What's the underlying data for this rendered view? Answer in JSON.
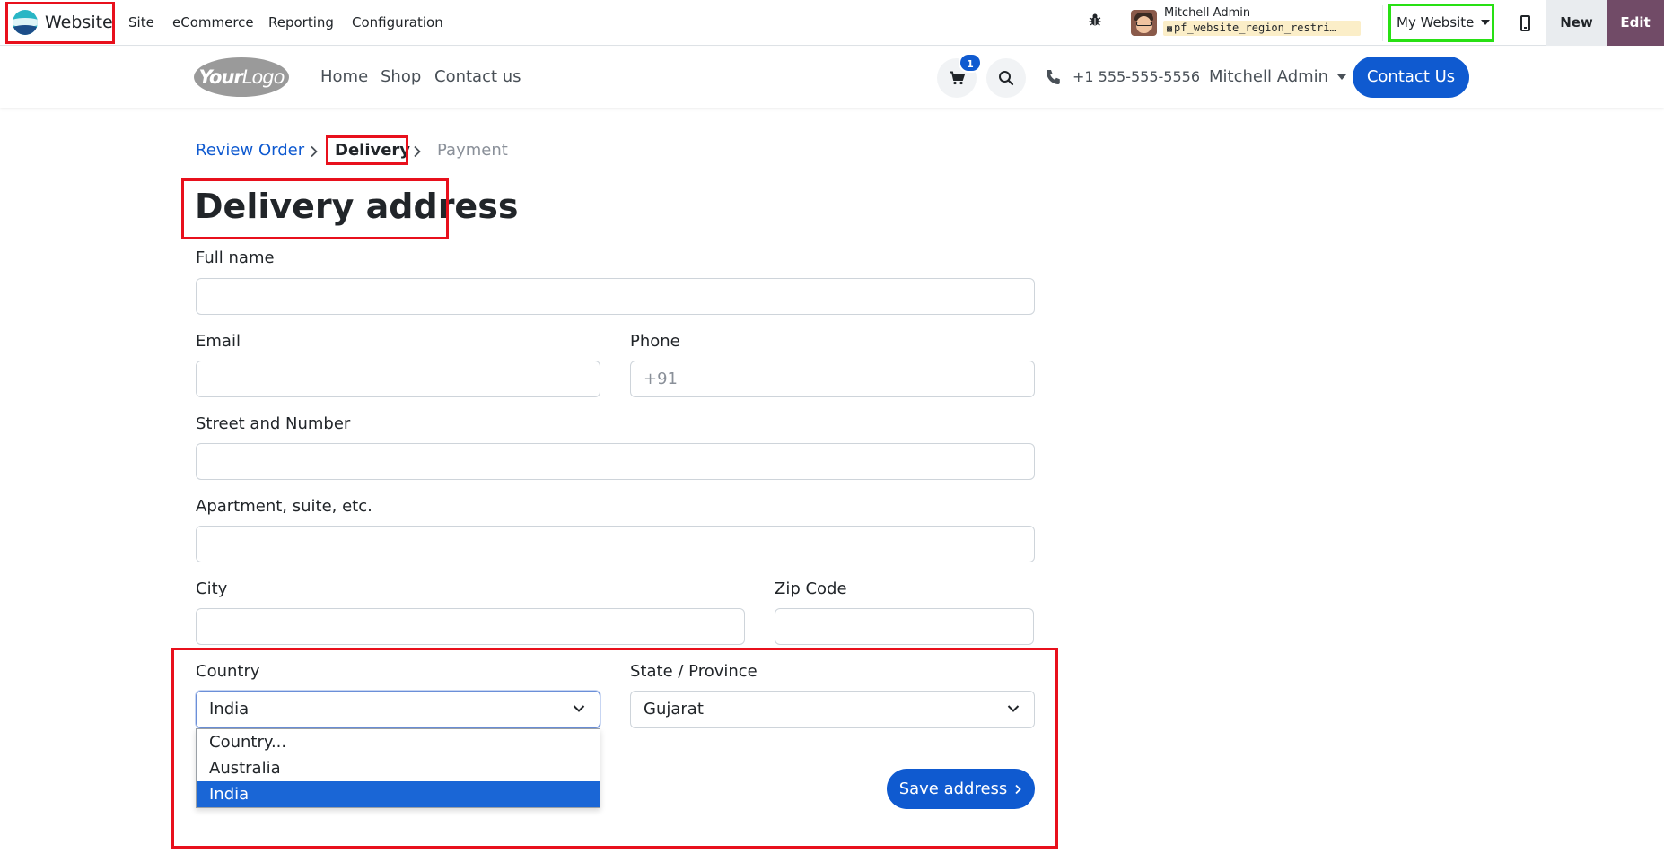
{
  "odoo_bar": {
    "app_name": "Website",
    "menu": [
      "Site",
      "eCommerce",
      "Reporting",
      "Configuration"
    ],
    "user_name": "Mitchell Admin",
    "database": "pf_website_region_restri…",
    "website_switcher": "My Website",
    "new_label": "New",
    "edit_label": "Edit",
    "edit_color": "#714b67"
  },
  "site_header": {
    "logo_text_bold": "Your",
    "logo_text_light": "Logo",
    "nav": [
      "Home",
      "Shop",
      "Contact us"
    ],
    "cart_count": "1",
    "phone": "+1 555-555-5556",
    "user": "Mitchell Admin",
    "contact_button": "Contact Us",
    "accent_color": "#0f5ad0"
  },
  "steps": {
    "review": "Review Order",
    "delivery": "Delivery",
    "payment": "Payment"
  },
  "form": {
    "title": "Delivery address",
    "full_name": {
      "label": "Full name",
      "value": ""
    },
    "email": {
      "label": "Email",
      "value": ""
    },
    "phone": {
      "label": "Phone",
      "placeholder": "+91"
    },
    "street": {
      "label": "Street and Number",
      "value": ""
    },
    "apartment": {
      "label": "Apartment, suite, etc.",
      "value": ""
    },
    "city": {
      "label": "City",
      "value": ""
    },
    "zip": {
      "label": "Zip Code",
      "value": ""
    },
    "country": {
      "label": "Country",
      "selected": "India",
      "options": [
        "Country...",
        "Australia",
        "India"
      ]
    },
    "state": {
      "label": "State / Province",
      "selected": "Gujarat"
    },
    "save_button": "Save address"
  },
  "icons": {
    "bug": "bug-icon",
    "cart": "cart-icon",
    "search": "search-icon",
    "phone": "phone-icon",
    "mobile_preview": "mobile-preview-icon",
    "database": "database-icon"
  },
  "annotation_colors": {
    "red": "#e8101c",
    "green": "#28e014"
  }
}
